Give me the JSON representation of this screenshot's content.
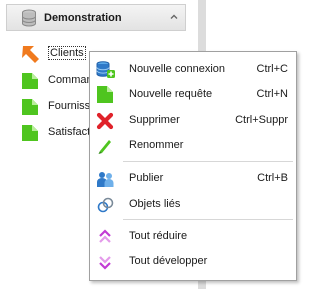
{
  "group": {
    "title": "Demonstration"
  },
  "tree": {
    "items": [
      {
        "label": "Clients",
        "icon": "cursor-arrow-icon"
      },
      {
        "label": "Comman",
        "icon": "green-page-icon"
      },
      {
        "label": "Fourniss",
        "icon": "green-page-icon"
      },
      {
        "label": "Satisfact",
        "icon": "green-page-icon"
      }
    ]
  },
  "menu": {
    "items": [
      {
        "label": "Nouvelle connexion",
        "shortcut": "Ctrl+C",
        "icon": "database-add-icon"
      },
      {
        "label": "Nouvelle requête",
        "shortcut": "Ctrl+N",
        "icon": "green-page-icon"
      },
      {
        "label": "Supprimer",
        "shortcut": "Ctrl+Suppr",
        "icon": "red-x-icon"
      },
      {
        "label": "Renommer",
        "shortcut": "",
        "icon": "pencil-icon"
      },
      {
        "label": "Publier",
        "shortcut": "Ctrl+B",
        "icon": "users-icon"
      },
      {
        "label": "Objets liés",
        "shortcut": "",
        "icon": "linked-rings-icon"
      },
      {
        "label": "Tout réduire",
        "shortcut": "",
        "icon": "collapse-all-icon"
      },
      {
        "label": "Tout développer",
        "shortcut": "",
        "icon": "expand-all-icon"
      }
    ]
  },
  "colors": {
    "green": "#4fc51f",
    "red": "#e0222a",
    "orange": "#f07a1e",
    "pink": "#c23bd4",
    "blue": "#2f79c8"
  }
}
